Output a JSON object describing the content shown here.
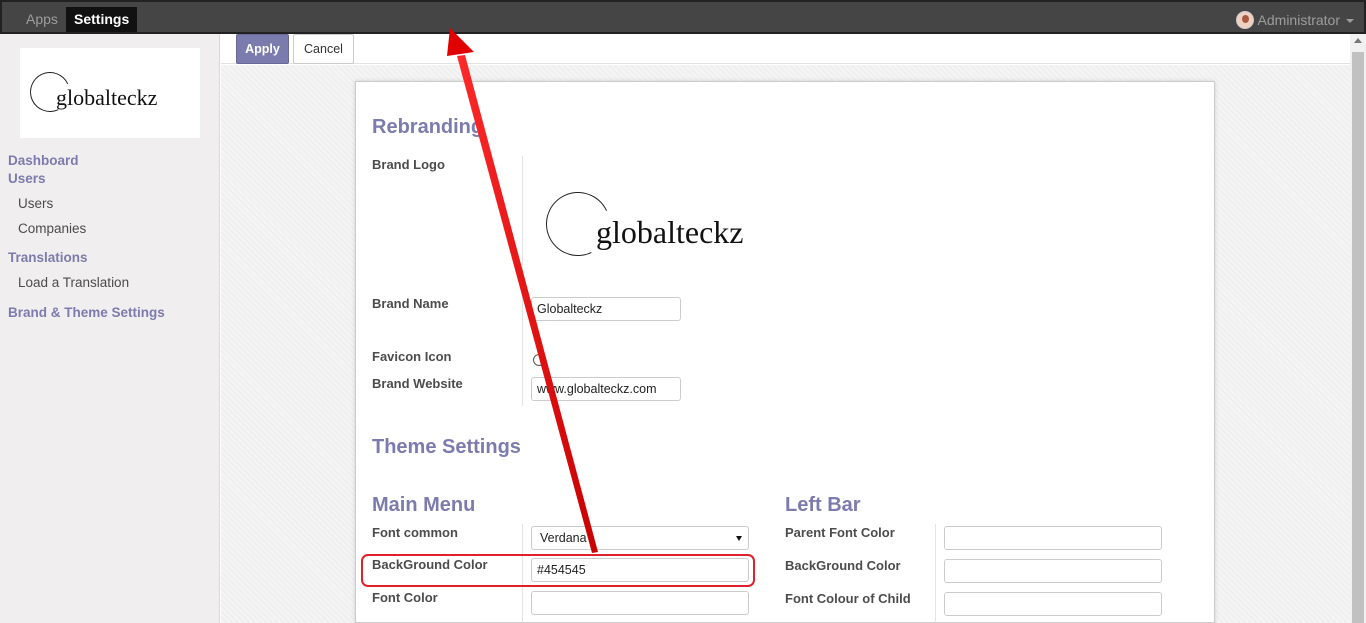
{
  "topbar": {
    "apps_label": "Apps",
    "settings_label": "Settings",
    "user_name": "Administrator"
  },
  "sidebar": {
    "logo_text": "globalteckz",
    "dashboard": "Dashboard",
    "users_section": "Users",
    "users_item": "Users",
    "companies_item": "Companies",
    "translations_section": "Translations",
    "load_translation_item": "Load a Translation",
    "brand_theme_section": "Brand & Theme Settings"
  },
  "control": {
    "apply_label": "Apply",
    "cancel_label": "Cancel"
  },
  "form": {
    "rebranding_title": "Rebranding",
    "brand_logo_label": "Brand Logo",
    "brand_logo_text": "globalteckz",
    "brand_name_label": "Brand Name",
    "brand_name_value": "Globalteckz",
    "favicon_label": "Favicon Icon",
    "brand_website_label": "Brand Website",
    "brand_website_value": "www.globalteckz.com",
    "theme_settings_title": "Theme Settings",
    "main_menu_title": "Main Menu",
    "left_bar_title": "Left Bar",
    "font_common_label": "Font common",
    "font_common_value": "Verdana",
    "background_color_label": "BackGround Color",
    "background_color_value": "#454545",
    "font_color_label": "Font Color",
    "font_color_value": "",
    "parent_font_color_label": "Parent Font Color",
    "parent_font_color_value": "",
    "left_background_color_label": "BackGround Color",
    "left_background_color_value": "",
    "font_colour_child_label": "Font Colour of Child",
    "font_colour_child_value": ""
  },
  "colors": {
    "topbar": "#454545",
    "accent": "#7c7bad",
    "annotation": "#e0202a"
  },
  "icons": {
    "user": "avatar-icon",
    "dropdown": "caret-down-icon",
    "select": "select-arrow-icon"
  }
}
